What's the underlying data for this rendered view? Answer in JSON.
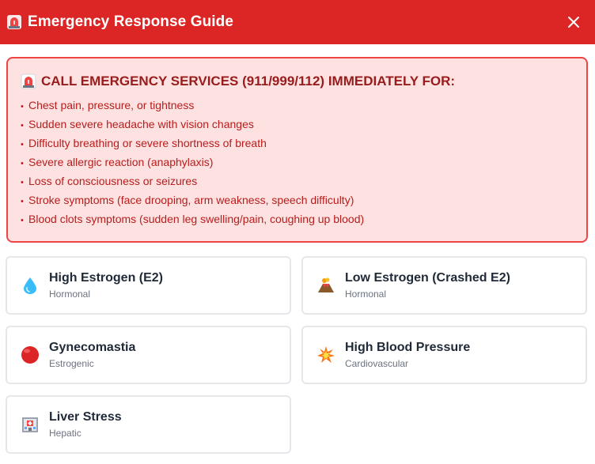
{
  "header": {
    "title": "Emergency Response Guide",
    "icon": "siren-icon",
    "close_icon": "close-icon",
    "bg_color": "#dc2626"
  },
  "alert": {
    "title": "CALL EMERGENCY SERVICES (911/999/112) IMMEDIATELY FOR:",
    "icon": "siren-icon",
    "items": [
      "Chest pain, pressure, or tightness",
      "Sudden severe headache with vision changes",
      "Difficulty breathing or severe shortness of breath",
      "Severe allergic reaction (anaphylaxis)",
      "Loss of consciousness or seizures",
      "Stroke symptoms (face drooping, arm weakness, speech difficulty)",
      "Blood clots symptoms (sudden leg swelling/pain, coughing up blood)"
    ]
  },
  "cards": [
    {
      "title": "High Estrogen (E2)",
      "subtitle": "Hormonal",
      "icon": "droplet-icon"
    },
    {
      "title": "Low Estrogen (Crashed E2)",
      "subtitle": "Hormonal",
      "icon": "volcano-icon"
    },
    {
      "title": "Gynecomastia",
      "subtitle": "Estrogenic",
      "icon": "red-circle-icon"
    },
    {
      "title": "High Blood Pressure",
      "subtitle": "Cardiovascular",
      "icon": "collision-icon"
    },
    {
      "title": "Liver Stress",
      "subtitle": "Hepatic",
      "icon": "hospital-icon"
    }
  ]
}
